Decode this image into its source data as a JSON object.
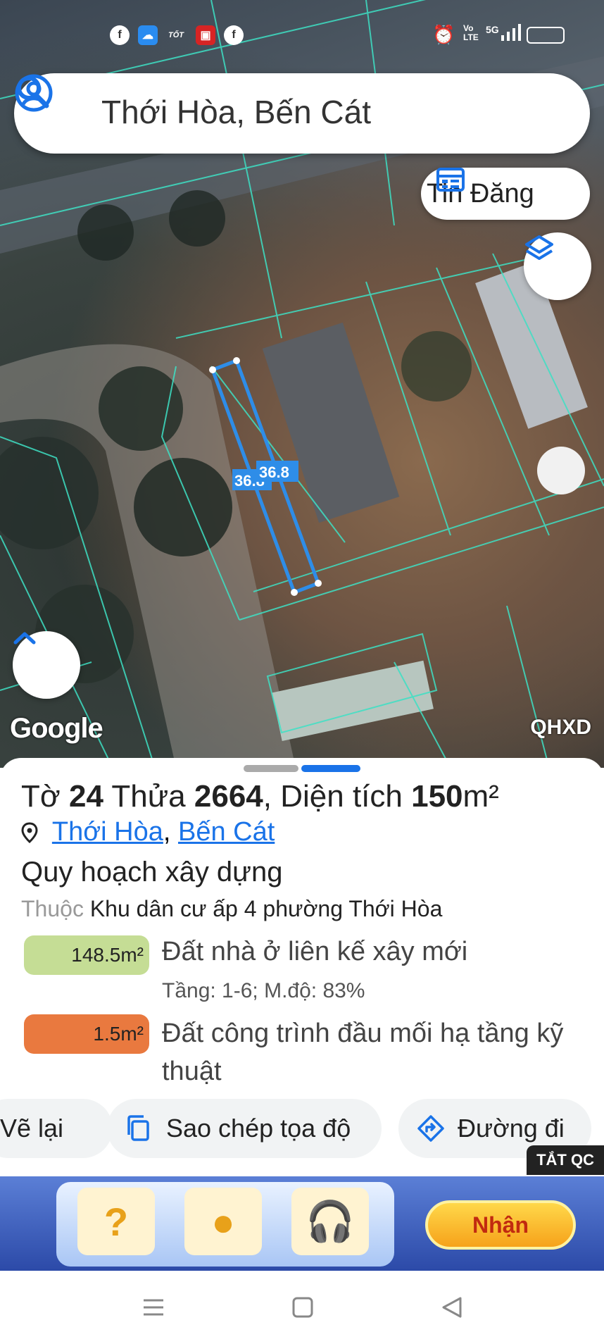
{
  "search": {
    "text": "Thới Hòa, Bến Cát"
  },
  "tin_dang": {
    "label": "Tin Đăng"
  },
  "map": {
    "provider_logo": "Google",
    "layer_label": "QHXD",
    "parcel_edge_label_1": "36.8",
    "parcel_edge_label_2": "36.8",
    "parcel_edge_color": "#2e8de8",
    "boundary_color": "#3ee0c4"
  },
  "info": {
    "to_label": "Tờ",
    "to_value": "24",
    "thua_label": "Thửa",
    "thua_value": "2664",
    "dien_tich_label": "Diện tích",
    "area_value": "150",
    "area_unit": "m²",
    "location_ward": "Thới Hòa",
    "location_separator": ",",
    "location_district": "Bến Cát",
    "plan_title": "Quy hoạch xây dựng",
    "belong_prefix": "Thuộc",
    "belong_name": "Khu dân cư ấp 4 phường Thới Hòa",
    "zones": [
      {
        "area": "148.5m²",
        "label": "Đất nhà ở liên kế xây mới",
        "detail": "Tầng: 1-6; M.độ: 83%",
        "color": "#c5dd95"
      },
      {
        "area": "1.5m²",
        "label": "Đất công trình đầu mối hạ tầng kỹ thuật",
        "detail": "",
        "color": "#e9793f"
      }
    ]
  },
  "actions": {
    "redraw": "Vẽ lại",
    "copy_coords": "Sao chép tọa độ",
    "directions": "Đường đi"
  },
  "ad": {
    "close_label": "TẮT QC",
    "cta": "Nhận",
    "tile_1": "?"
  },
  "status": {
    "icons": [
      "facebook-icon",
      "weather-icon",
      "tot-icon",
      "app-icon",
      "facebook-icon"
    ],
    "tot_text": "TỐT",
    "network": "5G",
    "volte": "Vo LTE"
  },
  "colors": {
    "accent": "#1a73e8"
  }
}
